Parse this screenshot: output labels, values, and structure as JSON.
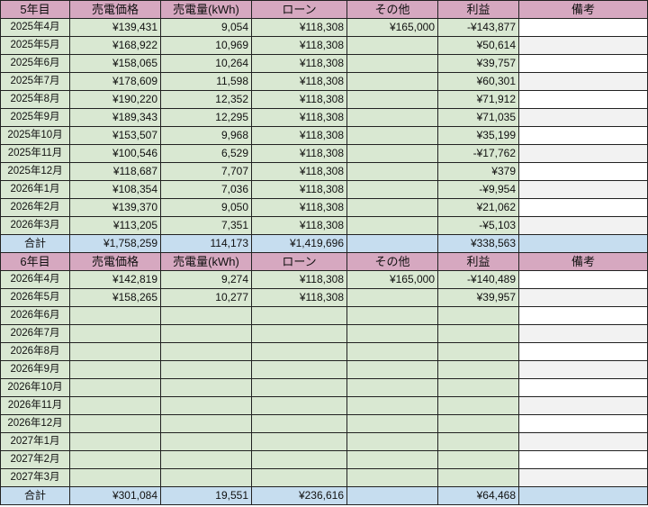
{
  "headers": [
    "売電価格",
    "売電量(kWh)",
    "ローン",
    "その他",
    "利益",
    "備考"
  ],
  "total_label": "合計",
  "year5": {
    "label": "5年目",
    "rows": [
      {
        "month": "2025年4月",
        "price": "¥139,431",
        "kwh": "9,054",
        "loan": "¥118,308",
        "other": "¥165,000",
        "profit": "-¥143,877",
        "note": ""
      },
      {
        "month": "2025年5月",
        "price": "¥168,922",
        "kwh": "10,969",
        "loan": "¥118,308",
        "other": "",
        "profit": "¥50,614",
        "note": ""
      },
      {
        "month": "2025年6月",
        "price": "¥158,065",
        "kwh": "10,264",
        "loan": "¥118,308",
        "other": "",
        "profit": "¥39,757",
        "note": ""
      },
      {
        "month": "2025年7月",
        "price": "¥178,609",
        "kwh": "11,598",
        "loan": "¥118,308",
        "other": "",
        "profit": "¥60,301",
        "note": ""
      },
      {
        "month": "2025年8月",
        "price": "¥190,220",
        "kwh": "12,352",
        "loan": "¥118,308",
        "other": "",
        "profit": "¥71,912",
        "note": ""
      },
      {
        "month": "2025年9月",
        "price": "¥189,343",
        "kwh": "12,295",
        "loan": "¥118,308",
        "other": "",
        "profit": "¥71,035",
        "note": ""
      },
      {
        "month": "2025年10月",
        "price": "¥153,507",
        "kwh": "9,968",
        "loan": "¥118,308",
        "other": "",
        "profit": "¥35,199",
        "note": ""
      },
      {
        "month": "2025年11月",
        "price": "¥100,546",
        "kwh": "6,529",
        "loan": "¥118,308",
        "other": "",
        "profit": "-¥17,762",
        "note": ""
      },
      {
        "month": "2025年12月",
        "price": "¥118,687",
        "kwh": "7,707",
        "loan": "¥118,308",
        "other": "",
        "profit": "¥379",
        "note": ""
      },
      {
        "month": "2026年1月",
        "price": "¥108,354",
        "kwh": "7,036",
        "loan": "¥118,308",
        "other": "",
        "profit": "-¥9,954",
        "note": ""
      },
      {
        "month": "2026年2月",
        "price": "¥139,370",
        "kwh": "9,050",
        "loan": "¥118,308",
        "other": "",
        "profit": "¥21,062",
        "note": ""
      },
      {
        "month": "2026年3月",
        "price": "¥113,205",
        "kwh": "7,351",
        "loan": "¥118,308",
        "other": "",
        "profit": "-¥5,103",
        "note": ""
      }
    ],
    "total": {
      "price": "¥1,758,259",
      "kwh": "114,173",
      "loan": "¥1,419,696",
      "other": "",
      "profit": "¥338,563",
      "note": ""
    }
  },
  "year6": {
    "label": "6年目",
    "rows": [
      {
        "month": "2026年4月",
        "price": "¥142,819",
        "kwh": "9,274",
        "loan": "¥118,308",
        "other": "¥165,000",
        "profit": "-¥140,489",
        "note": ""
      },
      {
        "month": "2026年5月",
        "price": "¥158,265",
        "kwh": "10,277",
        "loan": "¥118,308",
        "other": "",
        "profit": "¥39,957",
        "note": ""
      },
      {
        "month": "2026年6月",
        "price": "",
        "kwh": "",
        "loan": "",
        "other": "",
        "profit": "",
        "note": ""
      },
      {
        "month": "2026年7月",
        "price": "",
        "kwh": "",
        "loan": "",
        "other": "",
        "profit": "",
        "note": ""
      },
      {
        "month": "2026年8月",
        "price": "",
        "kwh": "",
        "loan": "",
        "other": "",
        "profit": "",
        "note": ""
      },
      {
        "month": "2026年9月",
        "price": "",
        "kwh": "",
        "loan": "",
        "other": "",
        "profit": "",
        "note": ""
      },
      {
        "month": "2026年10月",
        "price": "",
        "kwh": "",
        "loan": "",
        "other": "",
        "profit": "",
        "note": ""
      },
      {
        "month": "2026年11月",
        "price": "",
        "kwh": "",
        "loan": "",
        "other": "",
        "profit": "",
        "note": ""
      },
      {
        "month": "2026年12月",
        "price": "",
        "kwh": "",
        "loan": "",
        "other": "",
        "profit": "",
        "note": ""
      },
      {
        "month": "2027年1月",
        "price": "",
        "kwh": "",
        "loan": "",
        "other": "",
        "profit": "",
        "note": ""
      },
      {
        "month": "2027年2月",
        "price": "",
        "kwh": "",
        "loan": "",
        "other": "",
        "profit": "",
        "note": ""
      },
      {
        "month": "2027年3月",
        "price": "",
        "kwh": "",
        "loan": "",
        "other": "",
        "profit": "",
        "note": ""
      }
    ],
    "total": {
      "price": "¥301,084",
      "kwh": "19,551",
      "loan": "¥236,616",
      "other": "",
      "profit": "¥64,468",
      "note": ""
    }
  },
  "colors": {
    "header": "#d6a8c0",
    "data_cell": "#d9e8d2",
    "total_row": "#c6ddef",
    "note_alt": "#f2f2f2",
    "grid": "#222222"
  }
}
